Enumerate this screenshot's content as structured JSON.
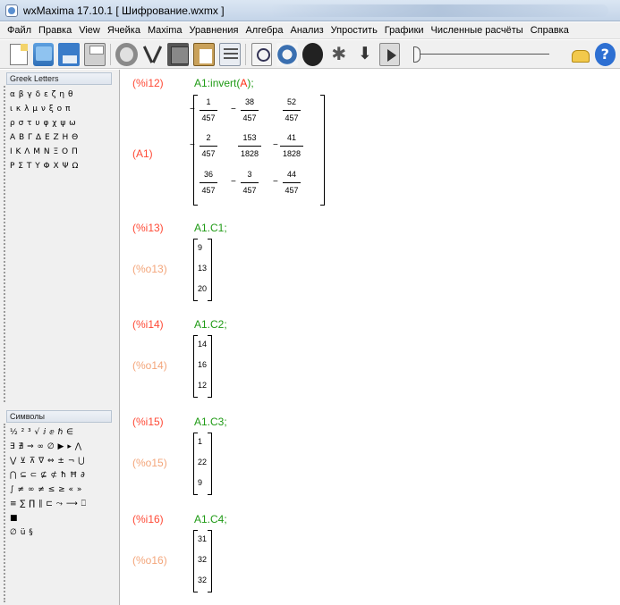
{
  "window": {
    "title": "wxMaxima 17.10.1 [ Шифрование.wxmx ]"
  },
  "menu": [
    "Файл",
    "Правка",
    "View",
    "Ячейка",
    "Maxima",
    "Уравнения",
    "Алгебра",
    "Анализ",
    "Упростить",
    "Графики",
    "Численные расчёты",
    "Справка"
  ],
  "toolbar": {
    "help_glyph": "?"
  },
  "greek_panel": {
    "title": "Greek Letters",
    "rows": [
      "α β γ δ ε ζ η θ",
      "ι κ λ μ ν ξ ο π",
      "ρ σ τ υ φ χ ψ ω",
      "Α Β Γ Δ Ε Ζ Η Θ",
      "Ι Κ Λ Μ Ν Ξ Ο Π",
      "Ρ Σ Τ Υ Φ Χ Ψ Ω"
    ]
  },
  "symbols_panel": {
    "title": "Символы",
    "rows": [
      "½ ² ³ √ ⅈ ⅇ ℏ ∈",
      "∃ ∄ ⇒ ∞ ∅ ▶ ▸ ⋀",
      "⋁ ⊻ ⊼ ∇ ⇔ ± ¬ ⋃",
      "⋂ ⊆ ⊂ ⊈ ⊄ ħ Ħ ∂",
      "∫ ≠ ∞ ≠ ≤ ≥ « »",
      "≡ ∑ ∏ ∥ ⊏ ⤳ ⟶ ⎕",
      "■",
      "∅ ü §"
    ]
  },
  "cells": [
    {
      "in_label": "(%i12)",
      "cmd_var": "A1",
      "cmd_mid": ":invert(",
      "cmd_arg": "A",
      "cmd_end": ");",
      "out_label": "(A1)",
      "matrix": [
        [
          {
            "neg": true,
            "num": "1",
            "den": "457"
          },
          {
            "neg": true,
            "num": "38",
            "den": "457"
          },
          {
            "neg": false,
            "num": "52",
            "den": "457"
          }
        ],
        [
          {
            "neg": true,
            "num": "2",
            "den": "457"
          },
          {
            "neg": false,
            "num": "153",
            "den": "1828"
          },
          {
            "neg": true,
            "num": "41",
            "den": "1828"
          }
        ],
        [
          {
            "neg": false,
            "num": "36",
            "den": "457"
          },
          {
            "neg": true,
            "num": "3",
            "den": "457"
          },
          {
            "neg": true,
            "num": "44",
            "den": "457"
          }
        ]
      ]
    },
    {
      "in_label": "(%i13)",
      "cmd": "A1.C1;",
      "out_label": "(%o13)",
      "vector": [
        "9",
        "13",
        "20"
      ]
    },
    {
      "in_label": "(%i14)",
      "cmd": "A1.C2;",
      "out_label": "(%o14)",
      "vector": [
        "14",
        "16",
        "12"
      ]
    },
    {
      "in_label": "(%i15)",
      "cmd": "A1.C3;",
      "out_label": "(%o15)",
      "vector": [
        "1",
        "22",
        "9"
      ]
    },
    {
      "in_label": "(%i16)",
      "cmd": "A1.C4;",
      "out_label": "(%o16)",
      "vector": [
        "31",
        "32",
        "32"
      ]
    }
  ]
}
